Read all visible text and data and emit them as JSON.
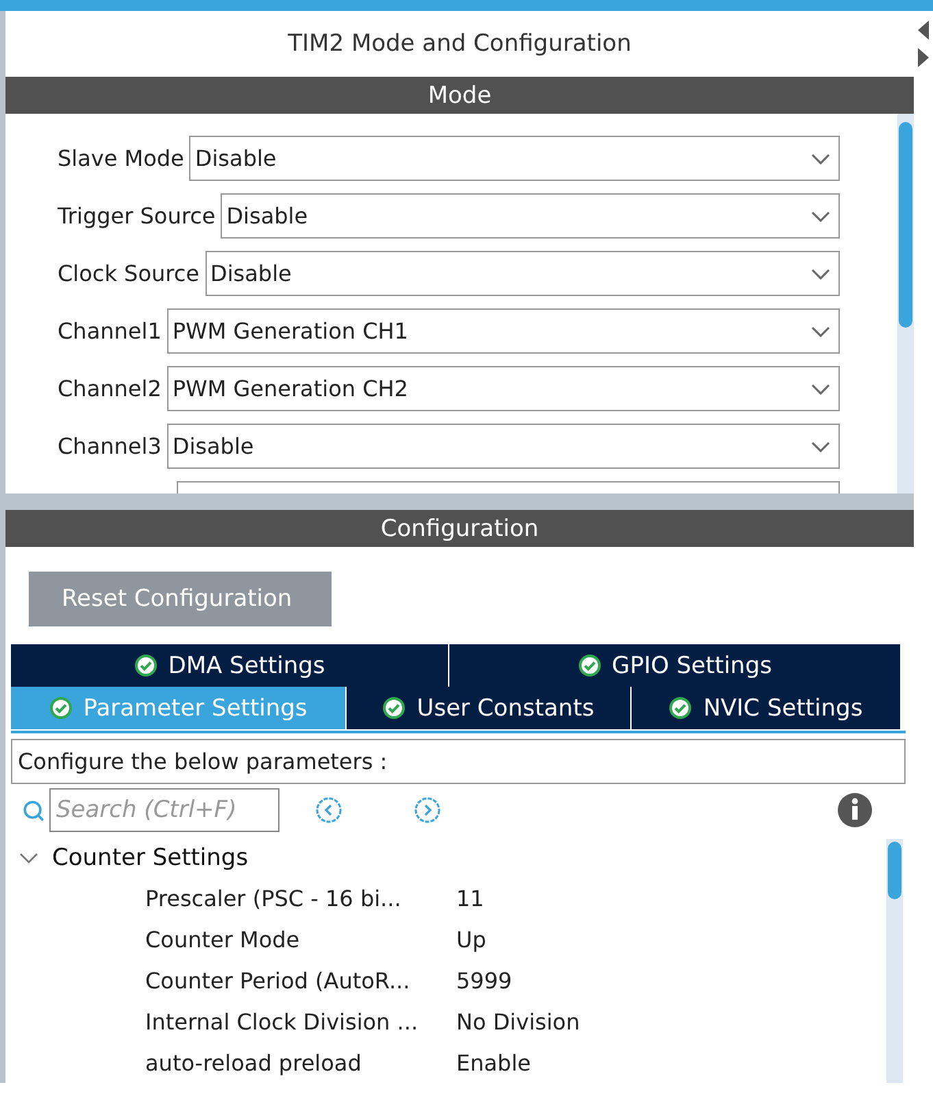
{
  "title": "TIM2 Mode and Configuration",
  "mode": {
    "header": "Mode",
    "fields": [
      {
        "label": "Slave Mode",
        "value": "Disable"
      },
      {
        "label": "Trigger Source",
        "value": "Disable"
      },
      {
        "label": "Clock Source",
        "value": "Disable"
      },
      {
        "label": "Channel1",
        "value": "PWM Generation CH1"
      },
      {
        "label": "Channel2",
        "value": "PWM Generation CH2"
      },
      {
        "label": "Channel3",
        "value": "Disable"
      }
    ]
  },
  "configuration": {
    "header": "Configuration",
    "reset_button": "Reset Configuration",
    "tabs": [
      [
        {
          "label": "DMA Settings",
          "selected": false
        },
        {
          "label": "GPIO Settings",
          "selected": false
        }
      ],
      [
        {
          "label": "Parameter Settings",
          "selected": true
        },
        {
          "label": "User Constants",
          "selected": false
        },
        {
          "label": "NVIC Settings",
          "selected": false
        }
      ]
    ],
    "description": "Configure the below parameters :",
    "search": {
      "placeholder": "Search (Ctrl+F)"
    },
    "tree": [
      {
        "label": "Counter Settings",
        "expanded": true,
        "children": [
          {
            "name": "Prescaler (PSC - 16 bi...",
            "value": "11"
          },
          {
            "name": "Counter Mode",
            "value": "Up"
          },
          {
            "name": "Counter Period (AutoR...",
            "value": "5999"
          },
          {
            "name": "Internal Clock Division ...",
            "value": "No Division"
          },
          {
            "name": "auto-reload preload",
            "value": "Enable"
          }
        ]
      }
    ]
  }
}
